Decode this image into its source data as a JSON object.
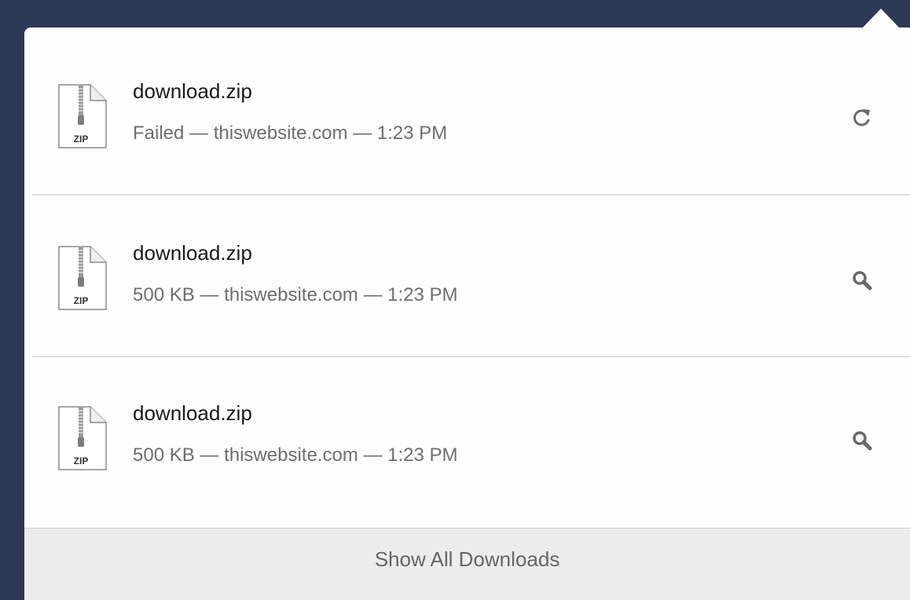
{
  "downloads": [
    {
      "filename": "download.zip",
      "meta": "Failed — thiswebsite.com — 1:23 PM",
      "icon_label": "ZIP",
      "action_icon": "retry-icon"
    },
    {
      "filename": "download.zip",
      "meta": "500 KB — thiswebsite.com — 1:23 PM",
      "icon_label": "ZIP",
      "action_icon": "magnifier-icon"
    },
    {
      "filename": "download.zip",
      "meta": "500 KB — thiswebsite.com — 1:23 PM",
      "icon_label": "ZIP",
      "action_icon": "magnifier-icon"
    }
  ],
  "footer": {
    "show_all_label": "Show All Downloads"
  },
  "colors": {
    "background": "#2e3a55",
    "panel": "#fdfdfd",
    "footer": "#ececec"
  }
}
